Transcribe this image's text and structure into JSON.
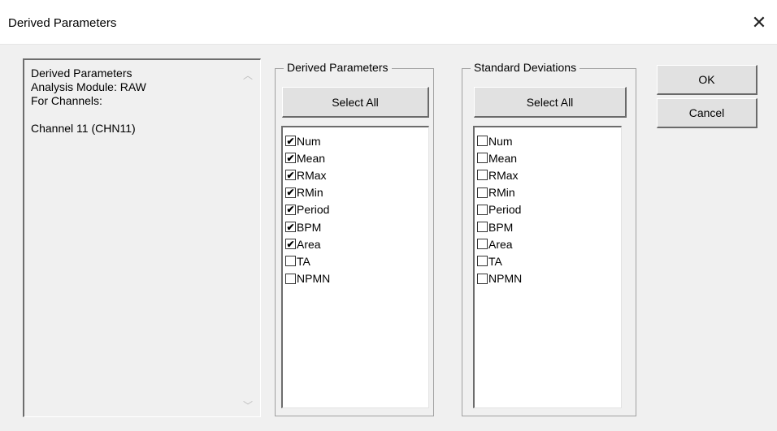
{
  "window": {
    "title": "Derived Parameters",
    "close_glyph": "✕"
  },
  "info": {
    "lines": [
      "Derived Parameters",
      "Analysis Module: RAW",
      "For Channels:",
      "",
      "Channel 11 (CHN11)"
    ],
    "scroll_up": "︿",
    "scroll_down": "﹀"
  },
  "derived": {
    "title": "Derived Parameters",
    "select_all": "Select All",
    "items": [
      {
        "label": "Num",
        "checked": true
      },
      {
        "label": "Mean",
        "checked": true
      },
      {
        "label": "RMax",
        "checked": true
      },
      {
        "label": "RMin",
        "checked": true
      },
      {
        "label": "Period",
        "checked": true
      },
      {
        "label": "BPM",
        "checked": true
      },
      {
        "label": "Area",
        "checked": true
      },
      {
        "label": "TA",
        "checked": false
      },
      {
        "label": "NPMN",
        "checked": false
      }
    ]
  },
  "stddev": {
    "title": "Standard Deviations",
    "select_all": "Select All",
    "items": [
      {
        "label": "Num",
        "checked": false
      },
      {
        "label": "Mean",
        "checked": false
      },
      {
        "label": "RMax",
        "checked": false
      },
      {
        "label": "RMin",
        "checked": false
      },
      {
        "label": "Period",
        "checked": false
      },
      {
        "label": "BPM",
        "checked": false
      },
      {
        "label": "Area",
        "checked": false
      },
      {
        "label": "TA",
        "checked": false
      },
      {
        "label": "NPMN",
        "checked": false
      }
    ]
  },
  "buttons": {
    "ok": "OK",
    "cancel": "Cancel"
  },
  "check_glyph": "✔"
}
